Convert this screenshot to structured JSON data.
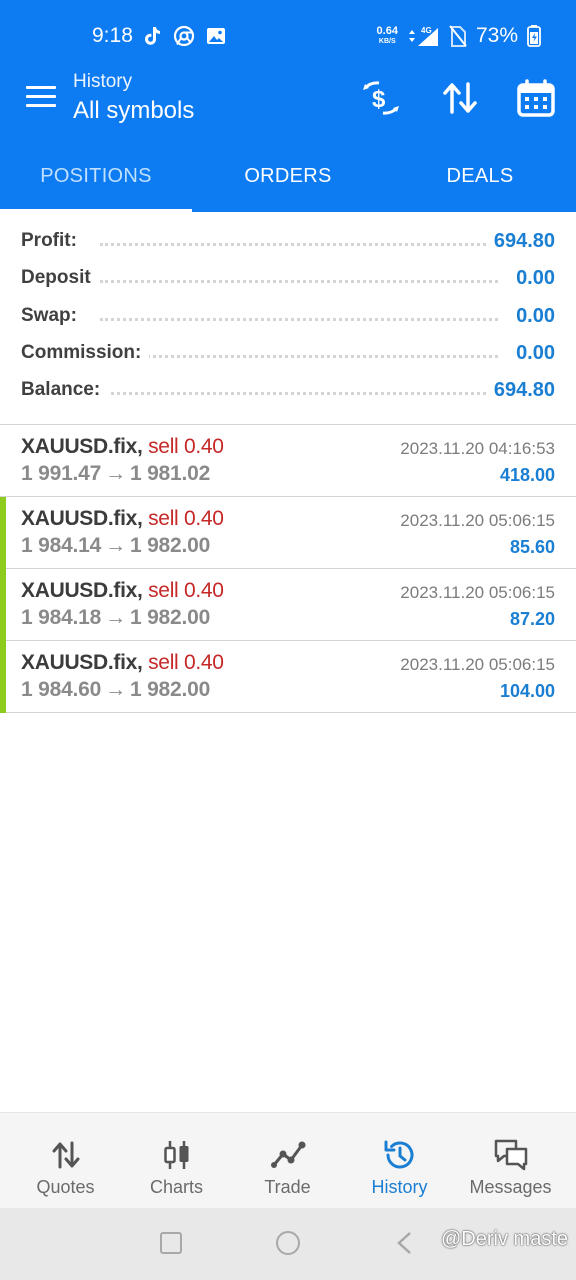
{
  "status_bar": {
    "time": "9:18",
    "net_speed_value": "0.64",
    "net_speed_unit": "KB/S",
    "network": "4G",
    "battery_percent": "73%"
  },
  "app_bar": {
    "subtitle": "History",
    "title": "All symbols"
  },
  "tabs": [
    {
      "label": "POSITIONS",
      "active": true
    },
    {
      "label": "ORDERS",
      "active": false
    },
    {
      "label": "DEALS",
      "active": false
    }
  ],
  "summary": [
    {
      "label": "Profit:",
      "value": "694.80"
    },
    {
      "label": "Deposit",
      "value": "0.00"
    },
    {
      "label": "Swap:",
      "value": "0.00"
    },
    {
      "label": "Commission:",
      "value": "0.00"
    },
    {
      "label": "Balance:",
      "value": "694.80"
    }
  ],
  "deals": [
    {
      "symbol": "XAUUSD.fix,",
      "side": "sell 0.40",
      "open_price": "1 991.47",
      "arrow": "→",
      "close_price": "1 981.02",
      "time": "2023.11.20 04:16:53",
      "profit": "418.00",
      "marked": false
    },
    {
      "symbol": "XAUUSD.fix,",
      "side": "sell 0.40",
      "open_price": "1 984.14",
      "arrow": "→",
      "close_price": "1 982.00",
      "time": "2023.11.20 05:06:15",
      "profit": "85.60",
      "marked": true
    },
    {
      "symbol": "XAUUSD.fix,",
      "side": "sell 0.40",
      "open_price": "1 984.18",
      "arrow": "→",
      "close_price": "1 982.00",
      "time": "2023.11.20 05:06:15",
      "profit": "87.20",
      "marked": true
    },
    {
      "symbol": "XAUUSD.fix,",
      "side": "sell 0.40",
      "open_price": "1 984.60",
      "arrow": "→",
      "close_price": "1 982.00",
      "time": "2023.11.20 05:06:15",
      "profit": "104.00",
      "marked": true
    }
  ],
  "bottom_nav": [
    {
      "label": "Quotes",
      "icon": "quotes-icon",
      "active": false
    },
    {
      "label": "Charts",
      "icon": "charts-icon",
      "active": false
    },
    {
      "label": "Trade",
      "icon": "trade-icon",
      "active": false
    },
    {
      "label": "History",
      "icon": "history-icon",
      "active": true
    },
    {
      "label": "Messages",
      "icon": "messages-icon",
      "active": false
    }
  ],
  "watermark": "@Deriv maste",
  "colors": {
    "app_bar": "#0d7bf2",
    "value_blue": "#1a7ed2",
    "sell_red": "#c62828",
    "marker_green": "#8ecb1f"
  }
}
